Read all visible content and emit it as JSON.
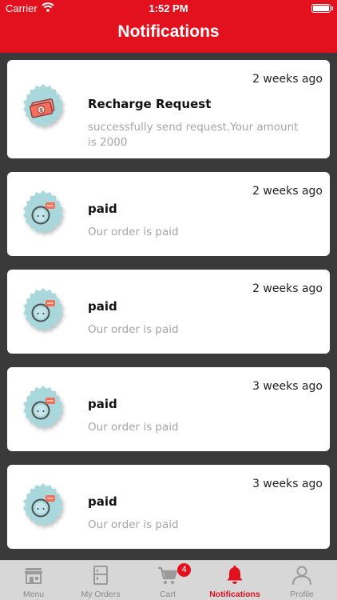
{
  "status_bar": {
    "carrier": "Carrier",
    "time": "1:52 PM"
  },
  "header": {
    "title": "Notifications"
  },
  "notifications": [
    {
      "time": "2 weeks ago",
      "title": "Recharge Request",
      "body": "successfully send request.Your amount is 2000",
      "icon": "money-icon"
    },
    {
      "time": "2 weeks ago",
      "title": "paid",
      "body": "Our order is paid",
      "icon": "order-status-icon"
    },
    {
      "time": "2 weeks ago",
      "title": "paid",
      "body": "Our order is paid",
      "icon": "order-status-icon"
    },
    {
      "time": "3 weeks ago",
      "title": "paid",
      "body": "Our order is paid",
      "icon": "order-status-icon"
    },
    {
      "time": "3 weeks ago",
      "title": "paid",
      "body": "Our order is paid",
      "icon": "order-status-icon"
    }
  ],
  "tabbar": {
    "tabs": [
      {
        "label": "Menu",
        "icon": "store-icon"
      },
      {
        "label": "My Orders",
        "icon": "orders-icon"
      },
      {
        "label": "Cart",
        "icon": "cart-icon",
        "count": "4"
      },
      {
        "label": "Notifications",
        "icon": "bell-icon",
        "active": true
      },
      {
        "label": "Profile",
        "icon": "profile-icon"
      }
    ]
  },
  "colors": {
    "accent": "#e3101e",
    "badge_bg": "#a9d8dc",
    "background": "#3a3a3a"
  }
}
